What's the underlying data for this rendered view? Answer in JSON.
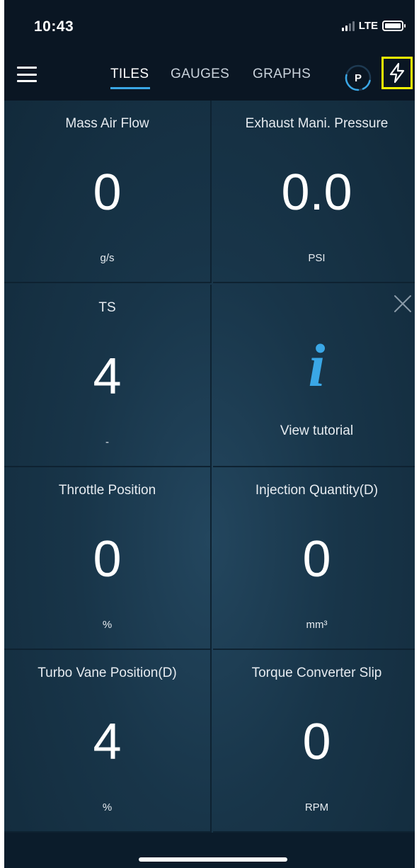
{
  "status_bar": {
    "time": "10:43",
    "network": "LTE"
  },
  "nav": {
    "tabs": [
      {
        "label": "TILES",
        "active": true
      },
      {
        "label": "GAUGES",
        "active": false
      },
      {
        "label": "GRAPHS",
        "active": false
      }
    ],
    "p_button": "P",
    "accent_color": "#3aa7e6",
    "highlight_color": "#f5f500"
  },
  "tiles": [
    {
      "title": "Mass Air Flow",
      "value": "0",
      "unit": "g/s"
    },
    {
      "title": "Exhaust Mani. Pressure",
      "value": "0.0",
      "unit": "PSI"
    },
    {
      "title": "TS",
      "value": "4",
      "unit": "-"
    },
    {
      "title": "Throttle Position",
      "value": "0",
      "unit": "%"
    },
    {
      "title": "Injection Quantity(D)",
      "value": "0",
      "unit": "mm³"
    },
    {
      "title": "Turbo Vane Position(D)",
      "value": "4",
      "unit": "%"
    },
    {
      "title": "Torque Converter Slip",
      "value": "0",
      "unit": "RPM"
    }
  ],
  "tutorial_tile": {
    "icon": "info-icon",
    "icon_glyph": "i",
    "label": "View tutorial"
  }
}
